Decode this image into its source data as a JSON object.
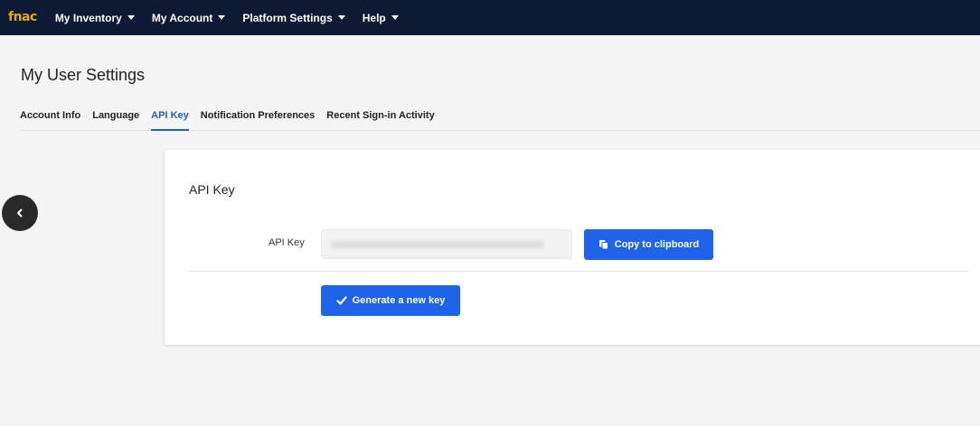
{
  "header": {
    "logo": "fnac",
    "nav": [
      {
        "label": "My Inventory"
      },
      {
        "label": "My Account"
      },
      {
        "label": "Platform Settings"
      },
      {
        "label": "Help"
      }
    ]
  },
  "page": {
    "title": "My User Settings",
    "tabs": [
      {
        "label": "Account Info"
      },
      {
        "label": "Language"
      },
      {
        "label": "API Key"
      },
      {
        "label": "Notification Preferences"
      },
      {
        "label": "Recent Sign-in Activity"
      }
    ],
    "active_tab": "API Key"
  },
  "card": {
    "title": "API Key",
    "field_label": "API Key",
    "copy_button": "Copy to clipboard",
    "generate_button": "Generate a new key"
  },
  "colors": {
    "topbar": "#0c1a33",
    "logo": "#e6a817",
    "accent": "#1e63e9",
    "active_tab": "#2060c8"
  }
}
